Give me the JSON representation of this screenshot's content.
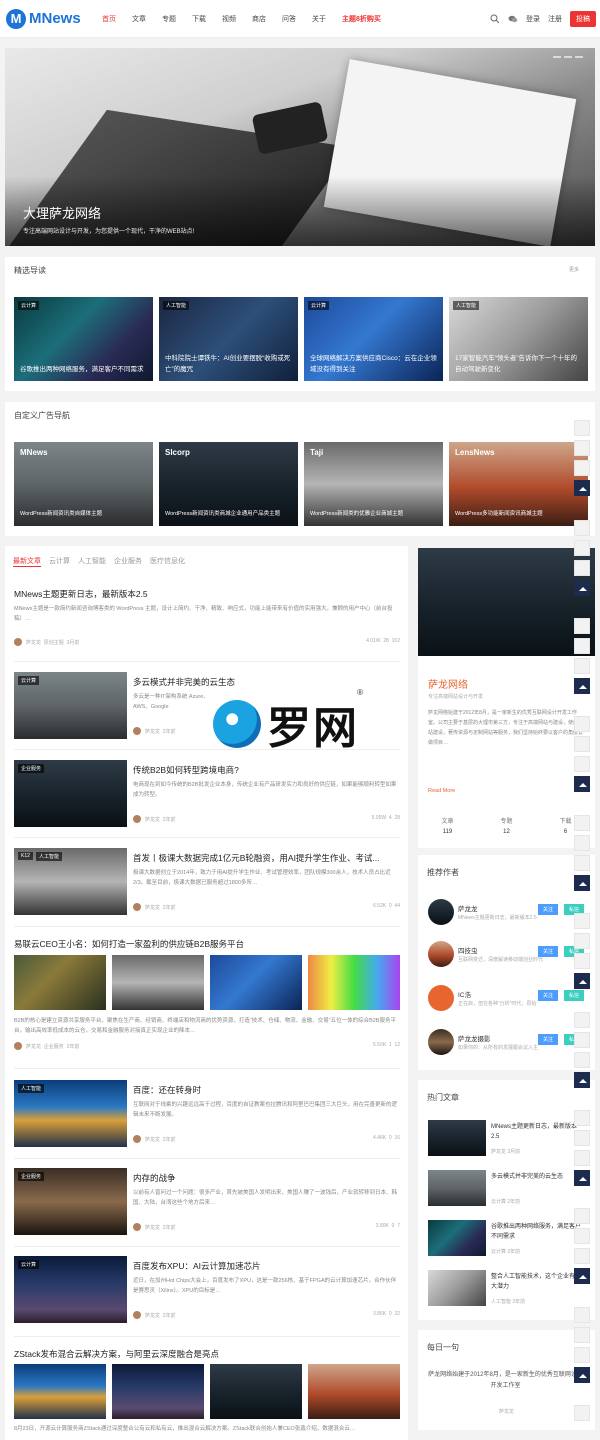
{
  "header": {
    "logo_letter": "M",
    "logo_text": "MNews",
    "nav": [
      "首页",
      "文章",
      "专题",
      "下载",
      "视频",
      "商店",
      "问答",
      "关于",
      "主题8折购买"
    ],
    "login": "登录",
    "register": "注册",
    "submit": "投稿"
  },
  "hero": {
    "title": "大理萨龙网络",
    "subtitle": "专注高端网站设计与开发，为您提供一个现代，干净的WEB站点!"
  },
  "featured": {
    "title": "精选导读",
    "more": "更多",
    "items": [
      {
        "tag": "云计算",
        "caption": "谷歌推出两种网络服务，满足客户不同需求"
      },
      {
        "tag": "人工智能",
        "caption": "中科院院士谭铁牛：AI创业要摆脱“收购或死亡”的魔咒"
      },
      {
        "tag": "云计算",
        "caption": "全球网络解决方案供应商Cisco：云在企业领域没有得到关注"
      },
      {
        "tag": "人工智能",
        "caption": "17家智能汽车“领头者”告诉你下一个十年的自动驾驶新变化"
      }
    ]
  },
  "ads": {
    "title": "自定义广告导航",
    "items": [
      {
        "name": "MNews",
        "caption": "WordPress新闻资讯类自媒体主题"
      },
      {
        "name": "Slcorp",
        "caption": "WordPress新闻资讯类商城企业通用产品类主题"
      },
      {
        "name": "Taji",
        "caption": "WordPress新闻类的优雅企业商城主题"
      },
      {
        "name": "LensNews",
        "caption": "WordPress多功能新闻资讯商城主题"
      }
    ]
  },
  "feed": {
    "tabs": [
      "最新文章",
      "云计算",
      "人工智能",
      "企业服务",
      "医疗信息化"
    ],
    "top": {
      "title": "MNews主题更新日志，最新版本2.5",
      "excerpt": "MNews主题是一款简约新闻咨询博客类的 WordPress 主题，设计上简约、干净、精致、响应式，功能上能带来有价值的实用强大，兼顾的用户中心（前台投稿）…",
      "author": "萨龙龙",
      "cat": "原创主题",
      "time": "3月前",
      "views": "4.01W",
      "comments": "28",
      "likes": "102"
    },
    "posts": [
      {
        "tag": "云计算",
        "title": "多云模式并非完美的云生态",
        "excerpt": "多云是一种IT架构系统 Azure、AWS、Google",
        "author": "萨龙龙",
        "time": "2年前",
        "views": "",
        "comments": "",
        "likes": ""
      },
      {
        "tag": "企业服务",
        "title": "传统B2B如何转型跨境电商?",
        "excerpt": "电商现在到如今传统的B2B批发企业本身，传统企业有产品研发实力和良好的供应链，如果能够顺利转型如果成为转型。",
        "author": "萨龙龙",
        "time": "2年前",
        "views": "5.05W",
        "comments": "4",
        "likes": "28"
      },
      {
        "tag": "人工智能",
        "tag2": "K12",
        "title": "首发丨极课大数据完成1亿元B轮融资，用AI提升学生作业、考试...",
        "excerpt": "极课大数据创立于2014年，致力于用AI提升学生作业、考试管理效率，团队规模300余人，技术人员占比近2/3。截至目前，极课大数据已服务超过1800多所…",
        "author": "萨龙龙",
        "time": "2年前",
        "views": "6.52K",
        "comments": "0",
        "likes": "44"
      }
    ],
    "wide": {
      "title": "易联云CEO王小名：如何打造一家盈利的供应链B2B服务平台",
      "excerpt": "B2B的核心是建立资源共享服务平台，聚焦在生产商、经销商、终端店和物流商的优势资源，打造“技术、仓储、物流、金融、交易”五位一体的综合B2B服务平台，输出高效率低成本的云仓，交易和金融服务对接真正实现企业的降本…",
      "author": "萨龙龙",
      "cat": "企业服务",
      "time": "2年前",
      "views": "5.50K",
      "comments": "1",
      "likes": "12"
    },
    "posts2": [
      {
        "tag": "人工智能",
        "title": "百度：还在转身时",
        "excerpt": "互联网对于线乘的兴趣远远高于过程，百度的自证教案也拉腾讯和阿里巴巴集团三大巨头，用在完善更新的逻辑未来不断发展。",
        "author": "萨龙龙",
        "time": "2年前",
        "views": "4.46K",
        "comments": "0",
        "likes": "16"
      },
      {
        "tag": "企业服务",
        "title": "内存的战争",
        "excerpt": "以前有人曾问过一个问题：很多产业，首先被美国人发明出来，美国人赚了一波钱后，产业就转移到日本、韩国、大陆，台湾这些个地方后来…",
        "author": "萨龙龙",
        "time": "2年前",
        "views": "3.80K",
        "comments": "0",
        "likes": "7"
      },
      {
        "tag": "云计算",
        "title": "百度发布XPU：AI云计算加速芯片",
        "excerpt": "近日，在加州Hot Chips大会上，百度发布了XPU，这是一款256核、基于FPGA的云计算加速芯片，合作伙伴是赛思灵（Xilinx）。XPU的目标是…",
        "author": "萨龙龙",
        "time": "2年前",
        "views": "3.86K",
        "comments": "0",
        "likes": "32"
      }
    ],
    "bottom": {
      "title": "ZStack发布混合云解决方案，与阿里云深度融合是亮点",
      "excerpt": "8月23日，开源云计算服务商ZStack通过深度整合公有云和私有云，推出混合云解决方案。ZStack联合创始人兼CEO张鑫介绍，数据混合云…"
    }
  },
  "profile": {
    "name": "萨龙网络",
    "sub": "专注高端网站设计与开发",
    "desc": "萨龙网络始建于2012年8月，是一家新生的优秀互联网设计开发工作室。公司主要于基层的大理市第三方，专注于高端网站与建设，使用网站建设，著传资源与定制网站等服务，我们坚持始终要以客户的角度去做项目…",
    "more": "Read More",
    "stats": [
      {
        "l": "文章",
        "v": "119"
      },
      {
        "l": "专题",
        "v": "12"
      },
      {
        "l": "下载",
        "v": "6"
      }
    ]
  },
  "authors": {
    "title": "推荐作者",
    "follow": "关注",
    "msg": "私信",
    "items": [
      {
        "name": "萨龙龙",
        "desc": "MNews主题更新日志，最新版本2.5"
      },
      {
        "name": "四技虫",
        "desc": "互联网变迁，深度解读移动端创业时代"
      },
      {
        "name": "IC浩",
        "desc": "正在启，但在各种“分析”时代，原始"
      },
      {
        "name": "萨龙龙摄影",
        "desc": "如果你的：从所有的发展跟会议入主"
      }
    ]
  },
  "hot": {
    "title": "热门文章",
    "items": [
      {
        "title": "MNews主题更新日志，最新版本2.5",
        "meta": "萨龙龙 3月前"
      },
      {
        "title": "多云模式并非完美的云生态",
        "meta": "云计算 2年前"
      },
      {
        "title": "谷歌推出两种网络服务，满足客户不同需求",
        "meta": "云计算 2年前"
      },
      {
        "title": "整合人工智能技术，这个企业有巨大潜力",
        "meta": "人工智能 2年前"
      }
    ]
  },
  "quote": {
    "title": "每日一句",
    "text": "萨龙网络始建于2012年8月，是一家新生的优秀互联网设计开发工作室",
    "author": "萨龙龙"
  },
  "watermark": {
    "text": "罗网",
    "mark": "®"
  }
}
